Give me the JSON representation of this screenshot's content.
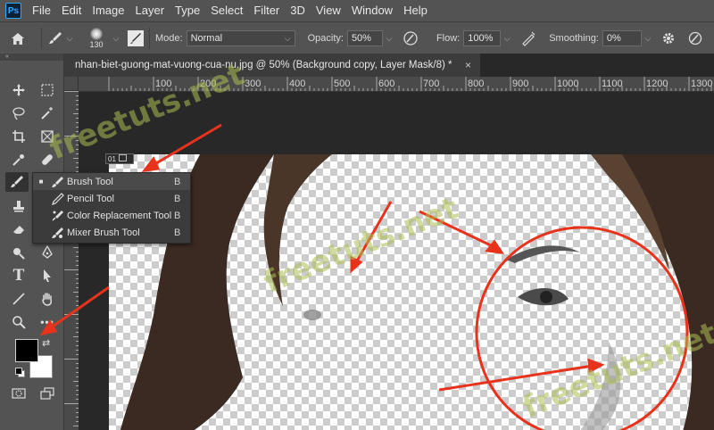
{
  "app": {
    "logo": "Ps"
  },
  "menu": [
    "File",
    "Edit",
    "Image",
    "Layer",
    "Type",
    "Select",
    "Filter",
    "3D",
    "View",
    "Window",
    "Help"
  ],
  "options": {
    "brush_size": "130",
    "mode_label": "Mode:",
    "mode_value": "Normal",
    "opacity_label": "Opacity:",
    "opacity_value": "50%",
    "flow_label": "Flow:",
    "flow_value": "100%",
    "smoothing_label": "Smoothing:",
    "smoothing_value": "0%"
  },
  "document": {
    "tab_title": "nhan-biet-guong-mat-vuong-cua-nu.jpg @ 50% (Background copy, Layer Mask/8) *",
    "close": "×",
    "layer_badge": "01"
  },
  "rulers": {
    "top_ticks": [
      "100",
      "200",
      "300",
      "400",
      "500",
      "600",
      "700",
      "800",
      "900",
      "1000",
      "1100",
      "1200",
      "1300"
    ]
  },
  "brush_flyout": [
    {
      "label": "Brush Tool",
      "key": "B",
      "selected": true
    },
    {
      "label": "Pencil Tool",
      "key": "B",
      "selected": false
    },
    {
      "label": "Color Replacement Tool",
      "key": "B",
      "selected": false
    },
    {
      "label": "Mixer Brush Tool",
      "key": "B",
      "selected": false
    }
  ],
  "colors": {
    "foreground": "#000000",
    "background": "#ffffff",
    "annotation": "#e8331c",
    "hair": "#3a2a22"
  },
  "watermark": "freetuts.net"
}
